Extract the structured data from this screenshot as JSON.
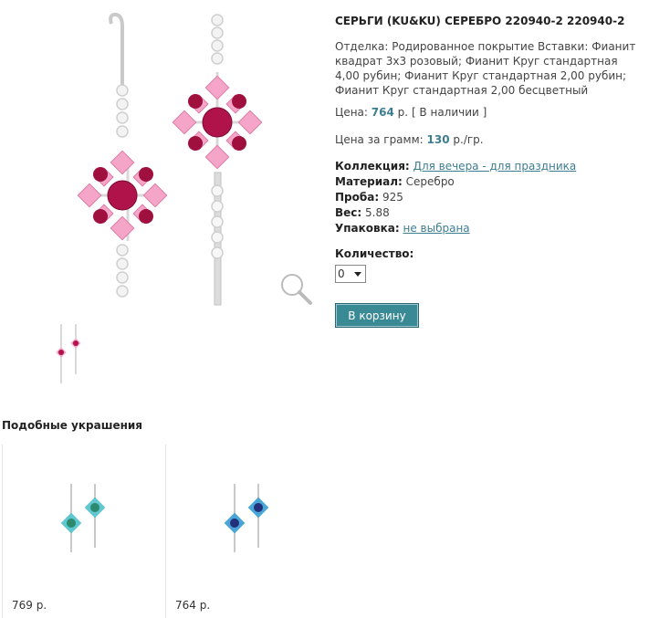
{
  "product": {
    "title": "СЕРЬГИ (KU&KU) СЕРЕБРО 220940-2 220940-2",
    "description": "Отделка: Родированное покрытие Вставки: Фианит квадрат 3х3 розовый; Фианит Круг стандартная 4,00 рубин; Фианит Круг стандартная 2,00 рубин; Фианит Круг стандартная 2,00 бесцветный",
    "price_label": "Цена:",
    "price_value": "764",
    "price_unit": "р.",
    "availability": "[ В наличии ]",
    "per_gram_label": "Цена за грамм:",
    "per_gram_value": "130",
    "per_gram_unit": "р./гр."
  },
  "props": {
    "collection_label": "Коллекция:",
    "collection_value": "Для вечера - для праздника",
    "material_label": "Материал:",
    "material_value": "Серебро",
    "proba_label": "Проба:",
    "proba_value": "925",
    "weight_label": "Вес:",
    "weight_value": "5.88",
    "package_label": "Упаковка:",
    "package_value": "не выбрана"
  },
  "quantity": {
    "label": "Количество:",
    "selected": "0"
  },
  "cart_button": "В корзину",
  "similar": {
    "title": "Подобные украшения",
    "items": [
      {
        "price": "769 р."
      },
      {
        "price": "764 р."
      }
    ]
  },
  "colors": {
    "accent": "#3d7d90",
    "button": "#3a8a96",
    "ruby": "#b0124a",
    "pink": "#f2a3c4"
  }
}
